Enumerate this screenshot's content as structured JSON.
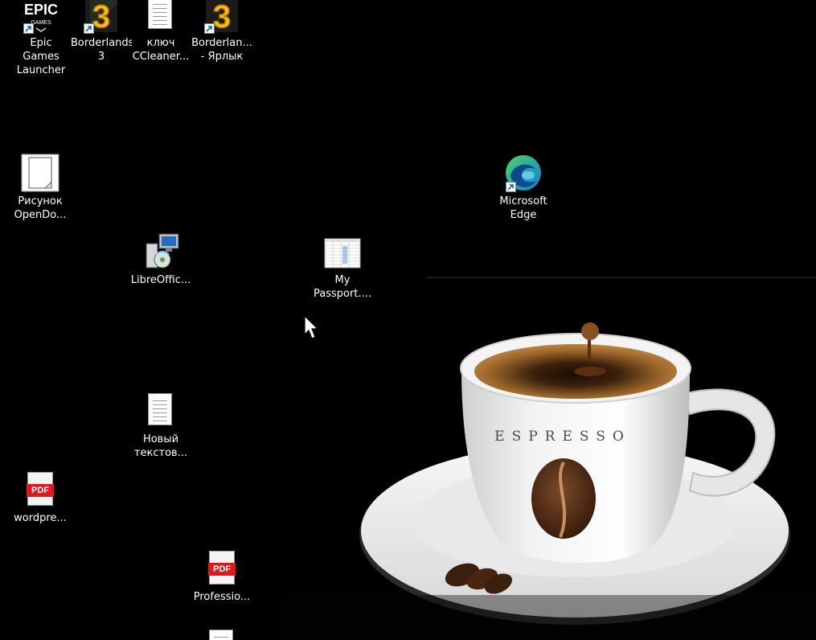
{
  "desktop": {
    "background_color": "#000000",
    "wallpaper": {
      "cup_text": "ESPRESSO"
    },
    "icons": [
      {
        "label": "Epic Games Launcher",
        "icon": "epic-games-icon",
        "shortcut": true
      },
      {
        "label": "Borderlands 3",
        "icon": "borderlands-3-icon",
        "shortcut": true
      },
      {
        "label": "ключ CCleaner...",
        "icon": "text-document-icon",
        "shortcut": false
      },
      {
        "label": "Borderlan... - Ярлык",
        "icon": "borderlands-3-icon",
        "shortcut": true
      },
      {
        "label": "Рисунок OpenDo...",
        "icon": "drawing-document-icon",
        "shortcut": false
      },
      {
        "label": "Microsoft Edge",
        "icon": "microsoft-edge-icon",
        "shortcut": true
      },
      {
        "label": "LibreOffic...",
        "icon": "installer-icon",
        "shortcut": false
      },
      {
        "label": "My Passport....",
        "icon": "spreadsheet-thumbnail-icon",
        "shortcut": false
      },
      {
        "label": "Новый текстов...",
        "icon": "text-document-icon",
        "shortcut": false
      },
      {
        "label": "wordpre...",
        "icon": "pdf-icon",
        "shortcut": false
      },
      {
        "label": "Professio...",
        "icon": "pdf-icon",
        "shortcut": false
      },
      {
        "label": "",
        "icon": "text-document-icon",
        "shortcut": false
      }
    ],
    "colors": {
      "label_text": "#ffffff",
      "pdf_red": "#e3161b",
      "edge_blue": "#0f7fd6",
      "edge_green": "#4fd066",
      "borderlands_yellow": "#f2c21b"
    }
  }
}
